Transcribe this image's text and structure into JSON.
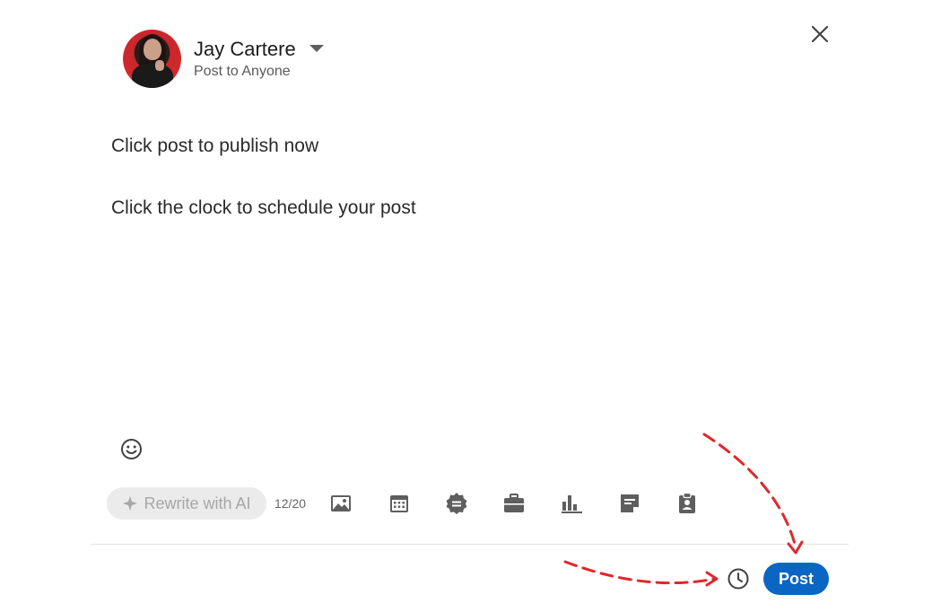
{
  "header": {
    "user_name": "Jay Cartere",
    "audience": "Post to Anyone",
    "avatar_icon": "profile-photo",
    "close_icon": "close-icon",
    "dropdown_icon": "caret-down-icon"
  },
  "editor": {
    "lines": [
      "Click post to publish now",
      "Click the clock to schedule your post"
    ],
    "emoji_icon": "smiley-icon"
  },
  "toolbar": {
    "rewrite_label": "Rewrite with AI",
    "rewrite_icon": "sparkle-icon",
    "char_count": "12/20",
    "tools": [
      "photo-icon",
      "calendar-event-icon",
      "celebrate-badge-icon",
      "briefcase-job-icon",
      "poll-chart-icon",
      "document-icon",
      "hiring-badge-icon"
    ]
  },
  "footer": {
    "schedule_icon": "clock-icon",
    "post_label": "Post"
  },
  "colors": {
    "primary": "#0a66c2",
    "annotation_arrow": "#e0282b",
    "pill_bg": "#ebebeb",
    "icon": "#5e5e5e"
  }
}
